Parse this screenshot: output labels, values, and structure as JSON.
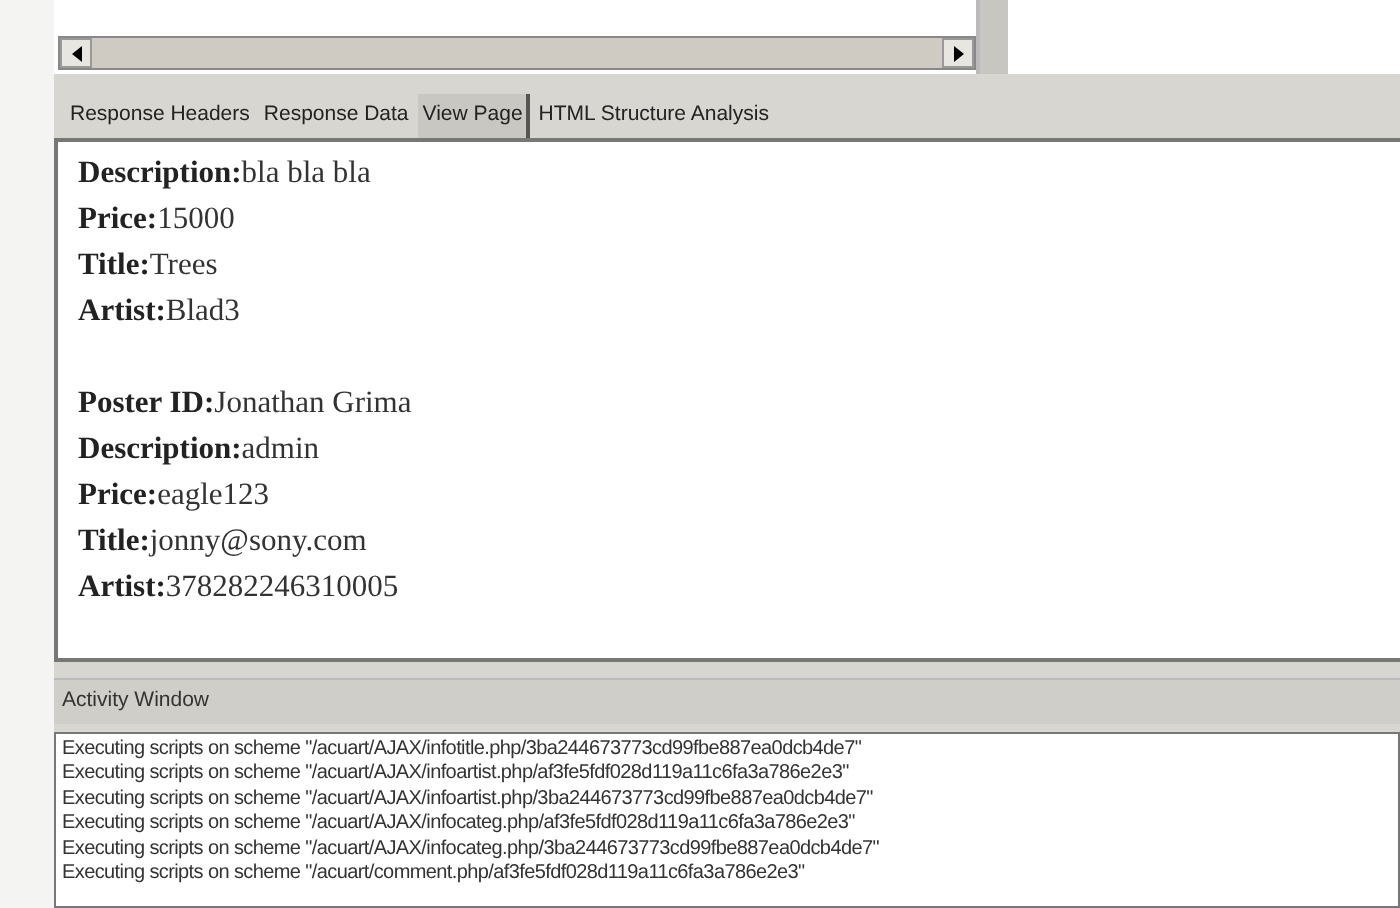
{
  "tabs": [
    {
      "label": "Response Headers",
      "selected": false
    },
    {
      "label": "Response Data",
      "selected": false
    },
    {
      "label": "View Page",
      "selected": true
    },
    {
      "label": "HTML Structure Analysis",
      "selected": false
    }
  ],
  "view_page": {
    "records": [
      {
        "fields": [
          {
            "label": "Description:",
            "value": "bla bla bla"
          },
          {
            "label": "Price:",
            "value": "15000"
          },
          {
            "label": "Title:",
            "value": "Trees"
          },
          {
            "label": "Artist:",
            "value": "Blad3"
          }
        ]
      },
      {
        "fields": [
          {
            "label": "Poster ID:",
            "value": "Jonathan Grima"
          },
          {
            "label": "Description:",
            "value": "admin"
          },
          {
            "label": "Price:",
            "value": "eagle123"
          },
          {
            "label": "Title:",
            "value": "jonny@sony.com"
          },
          {
            "label": "Artist:",
            "value": "378282246310005"
          }
        ]
      }
    ]
  },
  "activity_window": {
    "title": "Activity Window",
    "lines": [
      "Executing scripts on scheme \"/acuart/AJAX/infotitle.php/3ba244673773cd99fbe887ea0dcb4de7\"",
      "Executing scripts on scheme \"/acuart/AJAX/infoartist.php/af3fe5fdf028d119a11c6fa3a786e2e3\"",
      "Executing scripts on scheme \"/acuart/AJAX/infoartist.php/3ba244673773cd99fbe887ea0dcb4de7\"",
      "Executing scripts on scheme \"/acuart/AJAX/infocateg.php/af3fe5fdf028d119a11c6fa3a786e2e3\"",
      "Executing scripts on scheme \"/acuart/AJAX/infocateg.php/3ba244673773cd99fbe887ea0dcb4de7\"",
      "Executing scripts on scheme \"/acuart/comment.php/af3fe5fdf028d119a11c6fa3a786e2e3\""
    ]
  }
}
